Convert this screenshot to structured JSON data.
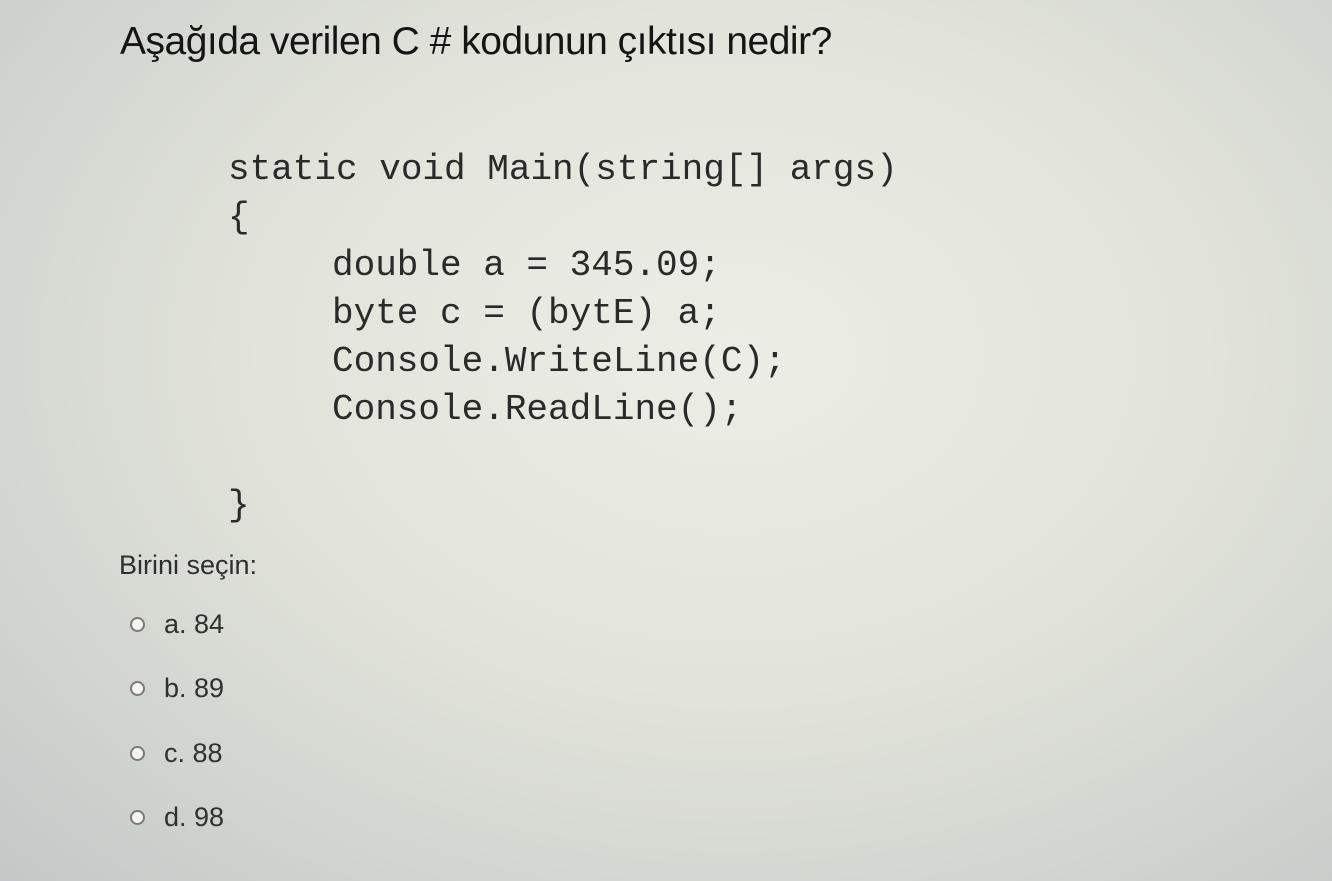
{
  "question": {
    "title": "Aşağıda verilen C # kodunun çıktısı nedir?"
  },
  "code": {
    "lines": [
      "static void Main(string[] args)",
      "{",
      "double a = 345.09;",
      "byte c = (bytE) a;",
      "Console.WriteLine(C);",
      "Console.ReadLine();",
      "}"
    ]
  },
  "answer_prompt": "Birini seçin:",
  "options": [
    {
      "label": "a. 84"
    },
    {
      "label": "b. 89"
    },
    {
      "label": "c. 88"
    },
    {
      "label": "d. 98"
    }
  ]
}
